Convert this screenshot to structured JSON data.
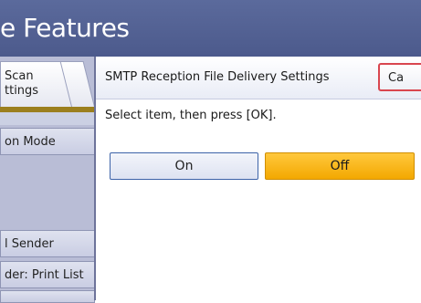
{
  "header": {
    "title": "e Features"
  },
  "background_tabs": {
    "scan_label": "Scan\nttings"
  },
  "side_menu": {
    "items": [
      {
        "label": "on Mode"
      },
      {
        "label": "l Sender"
      },
      {
        "label": "der: Print List"
      }
    ]
  },
  "dialog": {
    "title": "SMTP Reception File Delivery Settings",
    "cancel_label": "Ca",
    "instruction": "Select item, then press [OK].",
    "options": [
      {
        "label": "On",
        "selected": false
      },
      {
        "label": "Off",
        "selected": true
      }
    ]
  },
  "colors": {
    "titlebar": "#4f5d91",
    "selected_option": "#ffb81c",
    "cancel_border": "#d9464f"
  }
}
